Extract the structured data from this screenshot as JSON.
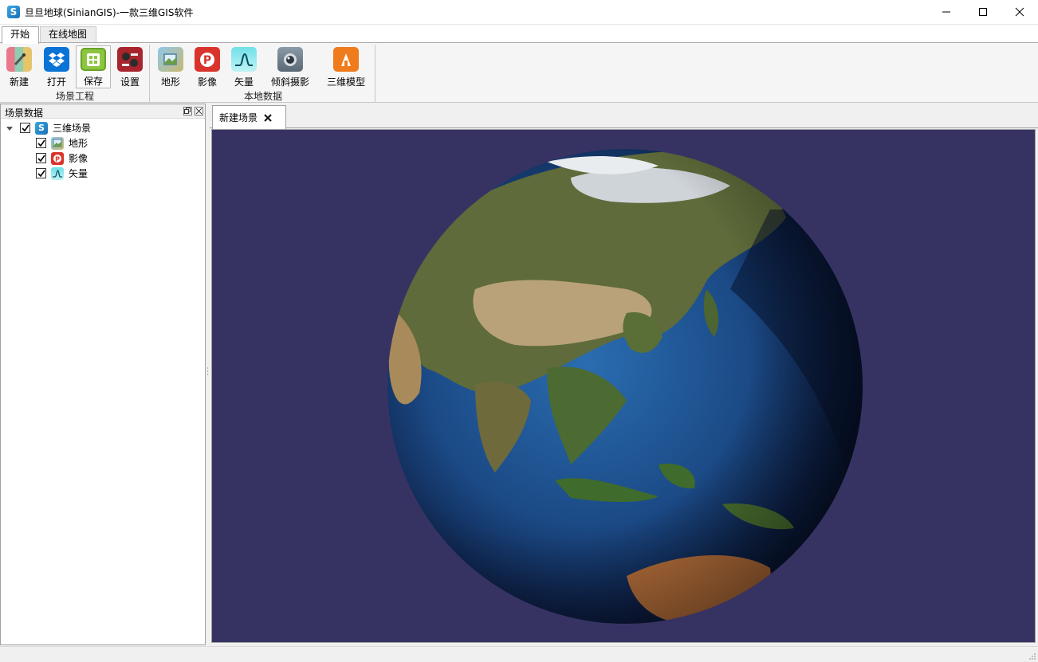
{
  "window": {
    "title": "旦旦地球(SinianGIS)-一款三维GIS软件",
    "logo_letter": "S"
  },
  "ribbon": {
    "tabs": [
      {
        "label": "开始",
        "active": true
      },
      {
        "label": "在线地图",
        "active": false
      }
    ],
    "groups": [
      {
        "label": "场景工程",
        "buttons": [
          {
            "label": "新建",
            "icon": "new-scene-icon"
          },
          {
            "label": "打开",
            "icon": "open-dropbox-icon"
          },
          {
            "label": "保存",
            "icon": "save-icon",
            "selected": true
          },
          {
            "label": "设置",
            "icon": "settings-icon"
          }
        ]
      },
      {
        "label": "本地数据",
        "buttons": [
          {
            "label": "地形",
            "icon": "terrain-icon"
          },
          {
            "label": "影像",
            "icon": "imagery-icon"
          },
          {
            "label": "矢量",
            "icon": "vector-icon"
          },
          {
            "label": "倾斜摄影",
            "icon": "oblique-photo-icon"
          },
          {
            "label": "三维模型",
            "icon": "3d-model-icon"
          }
        ]
      }
    ]
  },
  "scene_panel": {
    "title": "场景数据",
    "tree": {
      "root": {
        "label": "三维场景",
        "checked": true,
        "expanded": true
      },
      "children": [
        {
          "label": "地形",
          "checked": true
        },
        {
          "label": "影像",
          "checked": true
        },
        {
          "label": "矢量",
          "checked": true
        }
      ]
    }
  },
  "document": {
    "tab_label": "新建场景",
    "viewport_background": "#363363"
  },
  "colors": {
    "ribbon_bg": "#f5f5f5",
    "globe_ocean": "#1d4f8e",
    "deep_ocean": "#0c1a3a"
  }
}
